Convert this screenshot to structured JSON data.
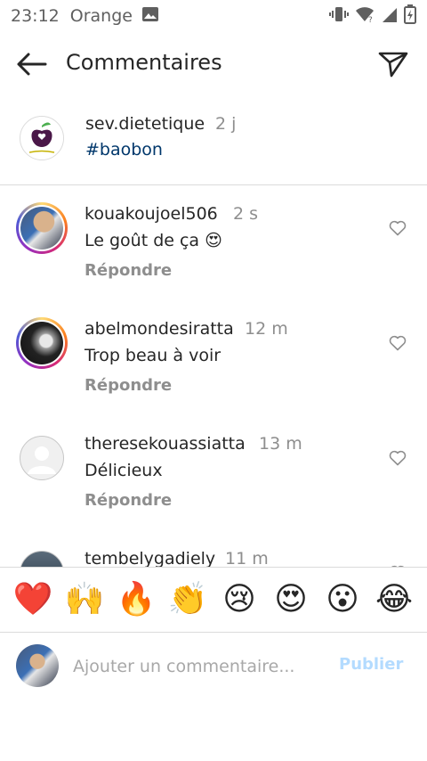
{
  "status": {
    "time": "23:12",
    "carrier": "Orange"
  },
  "header": {
    "title": "Commentaires"
  },
  "caption": {
    "username": "sev.dietetique",
    "time": "2 j",
    "text": "#baobon"
  },
  "comments": [
    {
      "username": "kouakoujoel506",
      "time": "2 s",
      "text": "Le goût de ça 😍",
      "reply": "Répondre"
    },
    {
      "username": "abelmondesiratta",
      "time": "12 m",
      "text": "Trop beau à voir",
      "reply": "Répondre"
    },
    {
      "username": "theresekouassiatta",
      "time": "13 m",
      "text": "Délicieux",
      "reply": "Répondre"
    },
    {
      "username": "tembelygadiely",
      "time": "11 m",
      "text": "",
      "reply": ""
    }
  ],
  "emoji_bar": [
    "❤️",
    "🙌",
    "🔥",
    "👏",
    "😢",
    "😍",
    "😮",
    "😂"
  ],
  "composer": {
    "placeholder": "Ajouter un commentaire...",
    "publish_label": "Publier"
  },
  "colors": {
    "link": "#00376b",
    "muted": "#8e8e8e",
    "publish_disabled": "#b3dbff"
  }
}
